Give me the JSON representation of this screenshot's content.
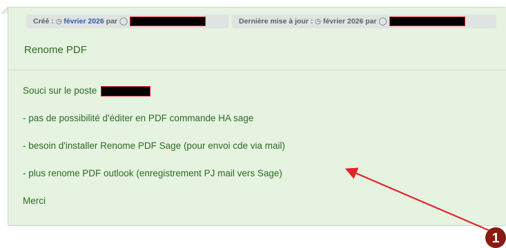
{
  "meta": {
    "created_label": "Créé :",
    "created_date": "février 2026",
    "created_by_label": "par",
    "updated_label": "Dernière mise à jour :",
    "updated_date": "février 2026",
    "updated_by_label": "par"
  },
  "ticket": {
    "title": "Renome PDF",
    "lines": [
      "Souci sur le poste",
      "- pas de possibilité d'éditer en PDF commande HA sage",
      "- besoin d'installer Renome PDF Sage  (pour envoi cde via mail)",
      "- plus renome PDF outlook (enregistrement PJ mail vers Sage)",
      "Merci"
    ]
  },
  "annotation": {
    "badge_number": "1",
    "arrow_color": "#e0242b",
    "badge_color": "#8b1a10"
  },
  "icons": {
    "clock": "clock-icon",
    "person": "person-icon"
  }
}
